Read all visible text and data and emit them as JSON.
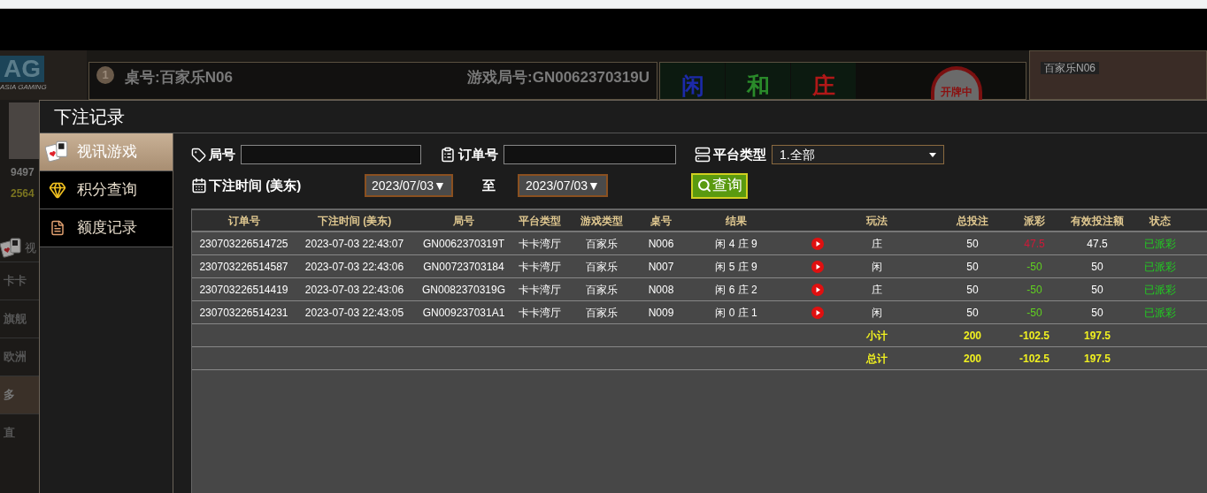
{
  "background": {
    "logo": "AG",
    "logo_tagline": "ASIA GAMING",
    "table_badge": "1",
    "table_title": "桌号:百家乐N06",
    "game_round": "游戏局号:GN0062370319U",
    "bet_areas": [
      {
        "label": "闲",
        "color": "#1c2aa8"
      },
      {
        "label": "和",
        "color": "#2a8a2a"
      },
      {
        "label": "庄",
        "color": "#b01818"
      }
    ],
    "dealing_status": "开牌中",
    "video_label": "百家乐N06",
    "balances": [
      "9497",
      "2564"
    ],
    "game_shortcut": "视",
    "halls": [
      {
        "label": "卡卡",
        "selected": false
      },
      {
        "label": "旗舰",
        "selected": false
      },
      {
        "label": "欧洲",
        "selected": false
      },
      {
        "label": "多",
        "selected": true
      },
      {
        "label": "直",
        "selected": false
      }
    ]
  },
  "dialog": {
    "title": "下注记录",
    "nav": [
      {
        "label": "视讯游戏",
        "kind": "cards",
        "selected": true
      },
      {
        "label": "积分查询",
        "kind": "gem",
        "selected": false
      },
      {
        "label": "额度记录",
        "kind": "document",
        "selected": false
      }
    ],
    "filters": {
      "round_label": "局号",
      "order_label": "订单号",
      "platform_label": "平台类型",
      "platform_value": "1.全部",
      "time_label": "下注时间 (美东)",
      "date_from": "2023/07/03▼",
      "to_label": "至",
      "date_to": "2023/07/03▼",
      "query_button": "查询"
    },
    "table": {
      "columns": [
        "订单号",
        "下注时间 (美东)",
        "局号",
        "平台类型",
        "游戏类型",
        "桌号",
        "结果",
        "玩法",
        "总投注",
        "派彩",
        "有效投注额",
        "状态"
      ],
      "rows": [
        {
          "order": "230703226514725",
          "time": "2023-07-03 22:43:07",
          "round": "GN0062370319T",
          "platform": "卡卡湾厅",
          "game": "百家乐",
          "table": "N006",
          "result": "闲 4 庄 9",
          "bet": "庄",
          "total": "50",
          "payout": "47.5",
          "color": "#d01838",
          "valid": "47.5",
          "status": "已派彩"
        },
        {
          "order": "230703226514587",
          "time": "2023-07-03 22:43:06",
          "round": "GN00723703184",
          "platform": "卡卡湾厅",
          "game": "百家乐",
          "table": "N007",
          "result": "闲 5 庄 9",
          "bet": "闲",
          "total": "50",
          "payout": "-50",
          "color": "#60d020",
          "valid": "50",
          "status": "已派彩"
        },
        {
          "order": "230703226514419",
          "time": "2023-07-03 22:43:06",
          "round": "GN0082370319G",
          "platform": "卡卡湾厅",
          "game": "百家乐",
          "table": "N008",
          "result": "闲 6 庄 2",
          "bet": "庄",
          "total": "50",
          "payout": "-50",
          "color": "#60d020",
          "valid": "50",
          "status": "已派彩"
        },
        {
          "order": "230703226514231",
          "time": "2023-07-03 22:43:05",
          "round": "GN009237031A1",
          "platform": "卡卡湾厅",
          "game": "百家乐",
          "table": "N009",
          "result": "闲 0 庄 1",
          "bet": "闲",
          "total": "50",
          "payout": "-50",
          "color": "#60d020",
          "valid": "50",
          "status": "已派彩"
        }
      ],
      "summaries": [
        {
          "label": "小计",
          "total": "200",
          "payout": "-102.5",
          "valid": "197.5"
        },
        {
          "label": "总计",
          "total": "200",
          "payout": "-102.5",
          "valid": "197.5"
        }
      ]
    }
  }
}
